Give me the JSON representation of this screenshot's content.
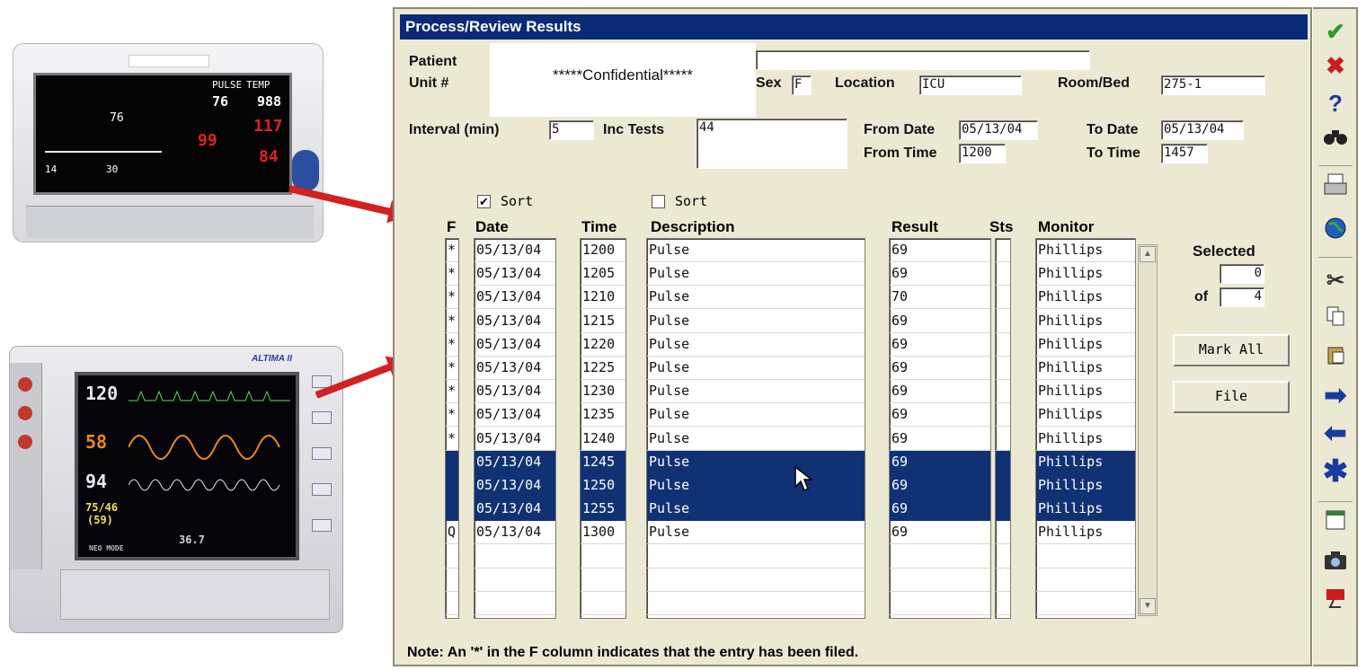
{
  "window": {
    "title": "Process/Review Results"
  },
  "header": {
    "patient_label": "Patient",
    "unit_label": "Unit #",
    "confidential": "*****Confidential*****",
    "sex_label": "Sex",
    "sex_value": "F",
    "location_label": "Location",
    "location_value": "ICU",
    "room_label": "Room/Bed",
    "room_value": "275-1",
    "interval_label": "Interval (min)",
    "interval_value": "5",
    "inc_tests_label": "Inc Tests",
    "inc_tests_value": "44",
    "from_date_label": "From Date",
    "from_date_value": "05/13/04",
    "to_date_label": "To Date",
    "to_date_value": "05/13/04",
    "from_time_label": "From Time",
    "from_time_value": "1200",
    "to_time_label": "To Time",
    "to_time_value": "1457"
  },
  "sort": {
    "label1": "Sort",
    "checked1": "✔",
    "label2": "Sort"
  },
  "table": {
    "headers": {
      "f": "F",
      "date": "Date",
      "time": "Time",
      "description": "Description",
      "result": "Result",
      "sts": "Sts",
      "monitor": "Monitor"
    },
    "rows": [
      {
        "f": "*",
        "date": "05/13/04",
        "time": "1200",
        "description": "Pulse",
        "result": "69",
        "sts": "",
        "monitor": "Phillips",
        "selected": false
      },
      {
        "f": "*",
        "date": "05/13/04",
        "time": "1205",
        "description": "Pulse",
        "result": "69",
        "sts": "",
        "monitor": "Phillips",
        "selected": false
      },
      {
        "f": "*",
        "date": "05/13/04",
        "time": "1210",
        "description": "Pulse",
        "result": "70",
        "sts": "",
        "monitor": "Phillips",
        "selected": false
      },
      {
        "f": "*",
        "date": "05/13/04",
        "time": "1215",
        "description": "Pulse",
        "result": "69",
        "sts": "",
        "monitor": "Phillips",
        "selected": false
      },
      {
        "f": "*",
        "date": "05/13/04",
        "time": "1220",
        "description": "Pulse",
        "result": "69",
        "sts": "",
        "monitor": "Phillips",
        "selected": false
      },
      {
        "f": "*",
        "date": "05/13/04",
        "time": "1225",
        "description": "Pulse",
        "result": "69",
        "sts": "",
        "monitor": "Phillips",
        "selected": false
      },
      {
        "f": "*",
        "date": "05/13/04",
        "time": "1230",
        "description": "Pulse",
        "result": "69",
        "sts": "",
        "monitor": "Phillips",
        "selected": false
      },
      {
        "f": "*",
        "date": "05/13/04",
        "time": "1235",
        "description": "Pulse",
        "result": "69",
        "sts": "",
        "monitor": "Phillips",
        "selected": false
      },
      {
        "f": "*",
        "date": "05/13/04",
        "time": "1240",
        "description": "Pulse",
        "result": "69",
        "sts": "",
        "monitor": "Phillips",
        "selected": false
      },
      {
        "f": "",
        "date": "05/13/04",
        "time": "1245",
        "description": "Pulse",
        "result": "69",
        "sts": "",
        "monitor": "Phillips",
        "selected": true
      },
      {
        "f": "",
        "date": "05/13/04",
        "time": "1250",
        "description": "Pulse",
        "result": "69",
        "sts": "",
        "monitor": "Phillips",
        "selected": true
      },
      {
        "f": "",
        "date": "05/13/04",
        "time": "1255",
        "description": "Pulse",
        "result": "69",
        "sts": "",
        "monitor": "Phillips",
        "selected": true
      },
      {
        "f": "Q",
        "date": "05/13/04",
        "time": "1300",
        "description": "Pulse",
        "result": "69",
        "sts": "",
        "monitor": "Phillips",
        "selected": false
      }
    ]
  },
  "selection": {
    "selected_label": "Selected",
    "selected_value": "0",
    "of_label": "of",
    "of_value": "4"
  },
  "buttons": {
    "mark_all": "Mark All",
    "file": "File"
  },
  "note": "Note: An '*' in the F column indicates that the entry has been filed.",
  "toolbar_icons": [
    "check-icon",
    "cancel-x-icon",
    "help-question-icon",
    "binoculars-icon",
    "print-icon",
    "globe-icon",
    "scissors-icon",
    "copy-icon",
    "paste-icon",
    "arrow-right-icon",
    "arrow-left-icon",
    "asterisk-icon",
    "calendar-icon",
    "camera-icon",
    "exit-icon"
  ],
  "devices": {
    "monitor1": {
      "top_labels": [
        "PULSE",
        "TEMP"
      ],
      "pulse": "76",
      "temp": "988",
      "systolic": "117",
      "spo2": "99",
      "diastolic": "84",
      "hr": "76",
      "rate1": "14",
      "rate2": "30"
    },
    "monitor2": {
      "brand": "ALTIMA II",
      "hr": "120",
      "rr": "58",
      "spo2": "94",
      "bp": "75/46",
      "map": "(59)",
      "temp": "36.7",
      "mode": "NEO MODE"
    }
  }
}
